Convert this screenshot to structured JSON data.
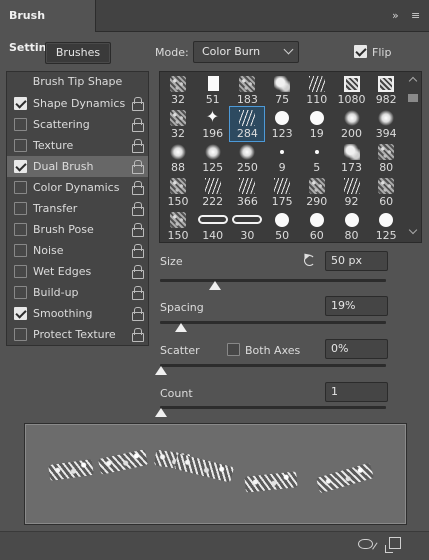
{
  "window": {
    "title": "Brush Settings",
    "collapse_glyph": "»",
    "menu_glyph": "≡"
  },
  "toolbar": {
    "brushes_label": "Brushes",
    "mode_label": "Mode:",
    "mode_value": "Color Burn",
    "flip_label": "Flip",
    "flip_checked": true
  },
  "options": {
    "header": "Brush Tip Shape",
    "items": [
      {
        "label": "Shape Dynamics",
        "checked": true,
        "locked": true
      },
      {
        "label": "Scattering",
        "checked": false,
        "locked": true
      },
      {
        "label": "Texture",
        "checked": false,
        "locked": true
      },
      {
        "label": "Dual Brush",
        "checked": true,
        "locked": true,
        "selected": true
      },
      {
        "label": "Color Dynamics",
        "checked": false,
        "locked": true
      },
      {
        "label": "Transfer",
        "checked": false,
        "locked": true
      },
      {
        "label": "Brush Pose",
        "checked": false,
        "locked": true
      },
      {
        "label": "Noise",
        "checked": false,
        "locked": true
      },
      {
        "label": "Wet Edges",
        "checked": false,
        "locked": true
      },
      {
        "label": "Build-up",
        "checked": false,
        "locked": true
      },
      {
        "label": "Smoothing",
        "checked": true,
        "locked": true
      },
      {
        "label": "Protect Texture",
        "checked": false,
        "locked": true
      }
    ]
  },
  "brush_tips": [
    {
      "size": "32",
      "kind": "texture"
    },
    {
      "size": "51",
      "kind": "doc"
    },
    {
      "size": "183",
      "kind": "texture"
    },
    {
      "size": "75",
      "kind": "splat"
    },
    {
      "size": "110",
      "kind": "strokes"
    },
    {
      "size": "1080",
      "kind": "boxed"
    },
    {
      "size": "982",
      "kind": "boxed"
    },
    {
      "size": "32",
      "kind": "texture"
    },
    {
      "size": "196",
      "kind": "star"
    },
    {
      "size": "284",
      "kind": "strokes",
      "selected": true
    },
    {
      "size": "123",
      "kind": "round"
    },
    {
      "size": "19",
      "kind": "round"
    },
    {
      "size": "200",
      "kind": "soft"
    },
    {
      "size": "394",
      "kind": "soft"
    },
    {
      "size": "88",
      "kind": "soft"
    },
    {
      "size": "125",
      "kind": "soft"
    },
    {
      "size": "250",
      "kind": "soft"
    },
    {
      "size": "9",
      "kind": "dot"
    },
    {
      "size": "5",
      "kind": "dot"
    },
    {
      "size": "173",
      "kind": "splat"
    },
    {
      "size": "80",
      "kind": "texture"
    },
    {
      "size": "150",
      "kind": "texture"
    },
    {
      "size": "222",
      "kind": "strokes"
    },
    {
      "size": "366",
      "kind": "strokes"
    },
    {
      "size": "175",
      "kind": "strokes"
    },
    {
      "size": "290",
      "kind": "texture"
    },
    {
      "size": "92",
      "kind": "strokes"
    },
    {
      "size": "60",
      "kind": "texture"
    },
    {
      "size": "150",
      "kind": "texture"
    },
    {
      "size": "140",
      "kind": "chain"
    },
    {
      "size": "30",
      "kind": "chain"
    },
    {
      "size": "50",
      "kind": "round"
    },
    {
      "size": "60",
      "kind": "round"
    },
    {
      "size": "80",
      "kind": "round"
    },
    {
      "size": "125",
      "kind": "round"
    }
  ],
  "params": {
    "size": {
      "label": "Size",
      "value": "50 px",
      "slider": 0.24
    },
    "spacing": {
      "label": "Spacing",
      "value": "19%",
      "slider": 0.09
    },
    "scatter": {
      "label": "Scatter",
      "both_axes_label": "Both Axes",
      "both_axes_checked": false,
      "value": "0%",
      "slider": 0.0
    },
    "count": {
      "label": "Count",
      "value": "1",
      "slider": 0.0
    }
  },
  "footer": {
    "toggle_preview_icon": "eye-slash-icon",
    "new_preset_icon": "new-preset-icon"
  }
}
